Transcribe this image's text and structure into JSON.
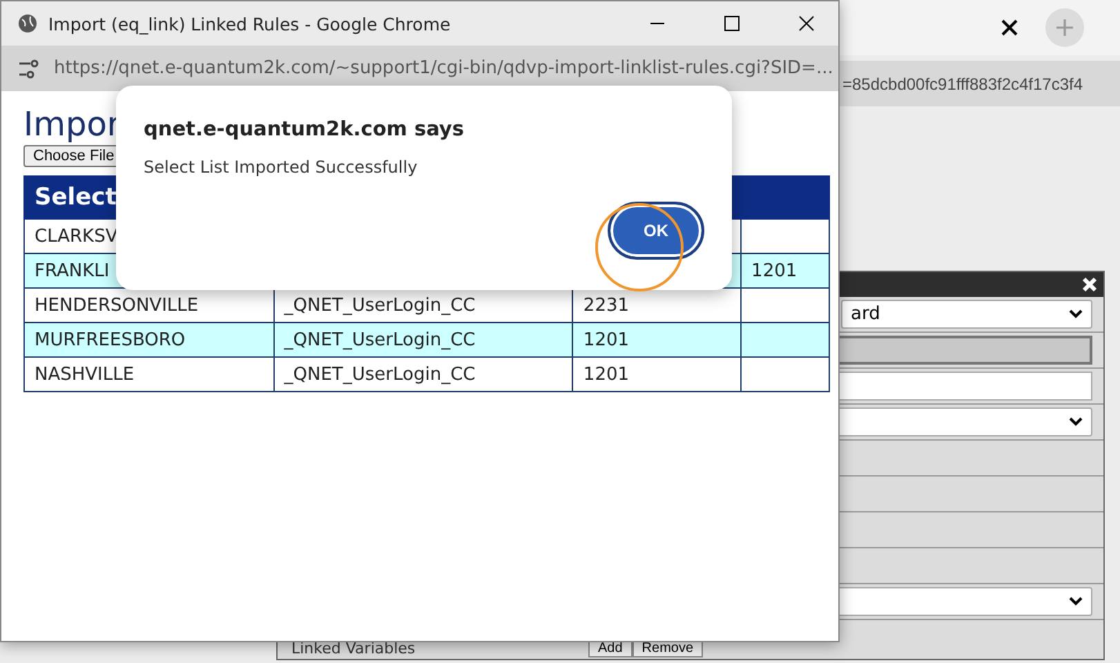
{
  "background_browser": {
    "url_tail": "=85dcbd00fc91fff883f2c4f17c3f4",
    "panel": {
      "select_value": "ard",
      "label": "Linked Variables",
      "buttons": [
        "Add",
        "Remove"
      ]
    }
  },
  "popup_window": {
    "title": "Import (eq_link) Linked Rules - Google Chrome",
    "url": "https://qnet.e-quantum2k.com/~support1/cgi-bin/qdvp-import-linklist-rules.cgi?SID=...",
    "heading": "Impor",
    "file_button": "Choose File",
    "table": {
      "columns": [
        "Select",
        "",
        "",
        ""
      ],
      "rows": [
        [
          "CLARKSV",
          "",
          "",
          ""
        ],
        [
          "FRANKLI",
          "",
          "",
          "1201"
        ],
        [
          "HENDERSONVILLE",
          "_QNET_UserLogin_CC",
          "2231",
          ""
        ],
        [
          "MURFREESBORO",
          "_QNET_UserLogin_CC",
          "1201",
          ""
        ],
        [
          "NASHVILLE",
          "_QNET_UserLogin_CC",
          "1201",
          ""
        ]
      ]
    }
  },
  "alert_dialog": {
    "title": "qnet.e-quantum2k.com says",
    "message": "Select List Imported Successfully",
    "button": "OK"
  }
}
